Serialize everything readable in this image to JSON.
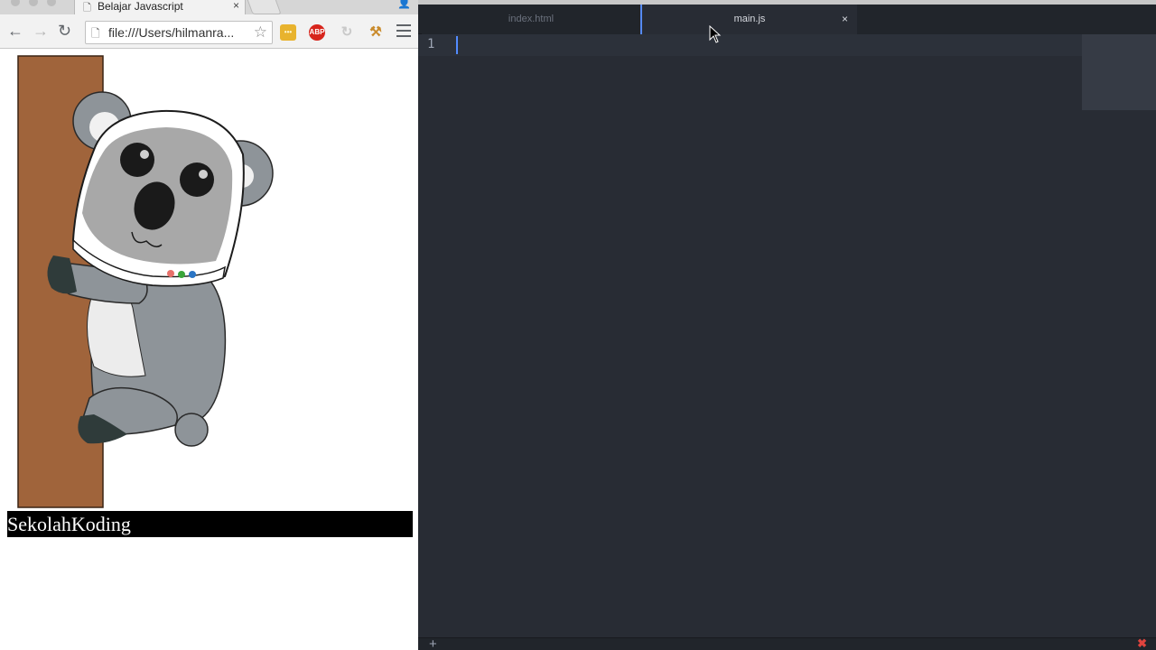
{
  "browser": {
    "tab_title": "Belajar Javascript",
    "tab_close": "×",
    "url": "file:///Users/hilmanra...",
    "extensions": {
      "abp_label": "ABP"
    },
    "page": {
      "brand_text": "SekolahKoding"
    }
  },
  "editor": {
    "tabs": [
      {
        "label": "index.html",
        "active": false
      },
      {
        "label": "main.js",
        "active": true,
        "close": "×"
      }
    ],
    "line_numbers": [
      "1"
    ],
    "status": {
      "add": "+",
      "error": "✖"
    }
  },
  "colors": {
    "editor_bg": "#282c34",
    "tab_accent": "#568af2",
    "koala_fur": "#8e9499",
    "tree_trunk": "#a0643b"
  }
}
